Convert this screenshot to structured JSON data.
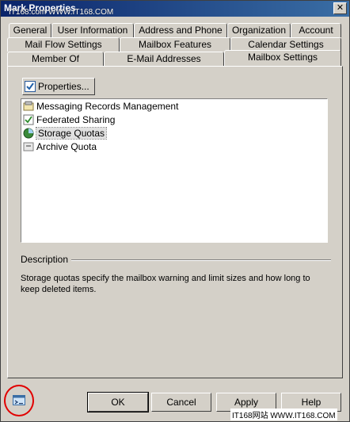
{
  "window": {
    "title": "Mark Properties",
    "close_label": "✕",
    "watermark_top": "IT168.com WWW.IT168.COM"
  },
  "tabs": {
    "row1": [
      "General",
      "User Information",
      "Address and Phone",
      "Organization",
      "Account"
    ],
    "row2": [
      "Mail Flow Settings",
      "Mailbox Features",
      "Calendar Settings"
    ],
    "row3": [
      "Member Of",
      "E-Mail Addresses",
      "Mailbox Settings"
    ],
    "active": "Mailbox Settings"
  },
  "panel": {
    "properties_button": "Properties...",
    "items": [
      {
        "label": "Messaging Records Management",
        "icon": "records-icon"
      },
      {
        "label": "Federated Sharing",
        "icon": "federated-icon"
      },
      {
        "label": "Storage Quotas",
        "icon": "quota-icon"
      },
      {
        "label": "Archive Quota",
        "icon": "archive-icon"
      }
    ],
    "selected_item": "Storage Quotas",
    "description_heading": "Description",
    "description_text": "Storage quotas specify the mailbox warning and limit sizes and how long to keep deleted items."
  },
  "footer": {
    "ok_label": "OK",
    "cancel_label": "Cancel",
    "apply_label": "Apply",
    "help_label": "Help",
    "watermark_bottom": "IT168网站 WWW.IT168.COM"
  },
  "colors": {
    "window_bg": "#d4d0c8",
    "titlebar_start": "#0a246a",
    "titlebar_end": "#3a6ea5",
    "highlight_circle": "#e10000"
  }
}
